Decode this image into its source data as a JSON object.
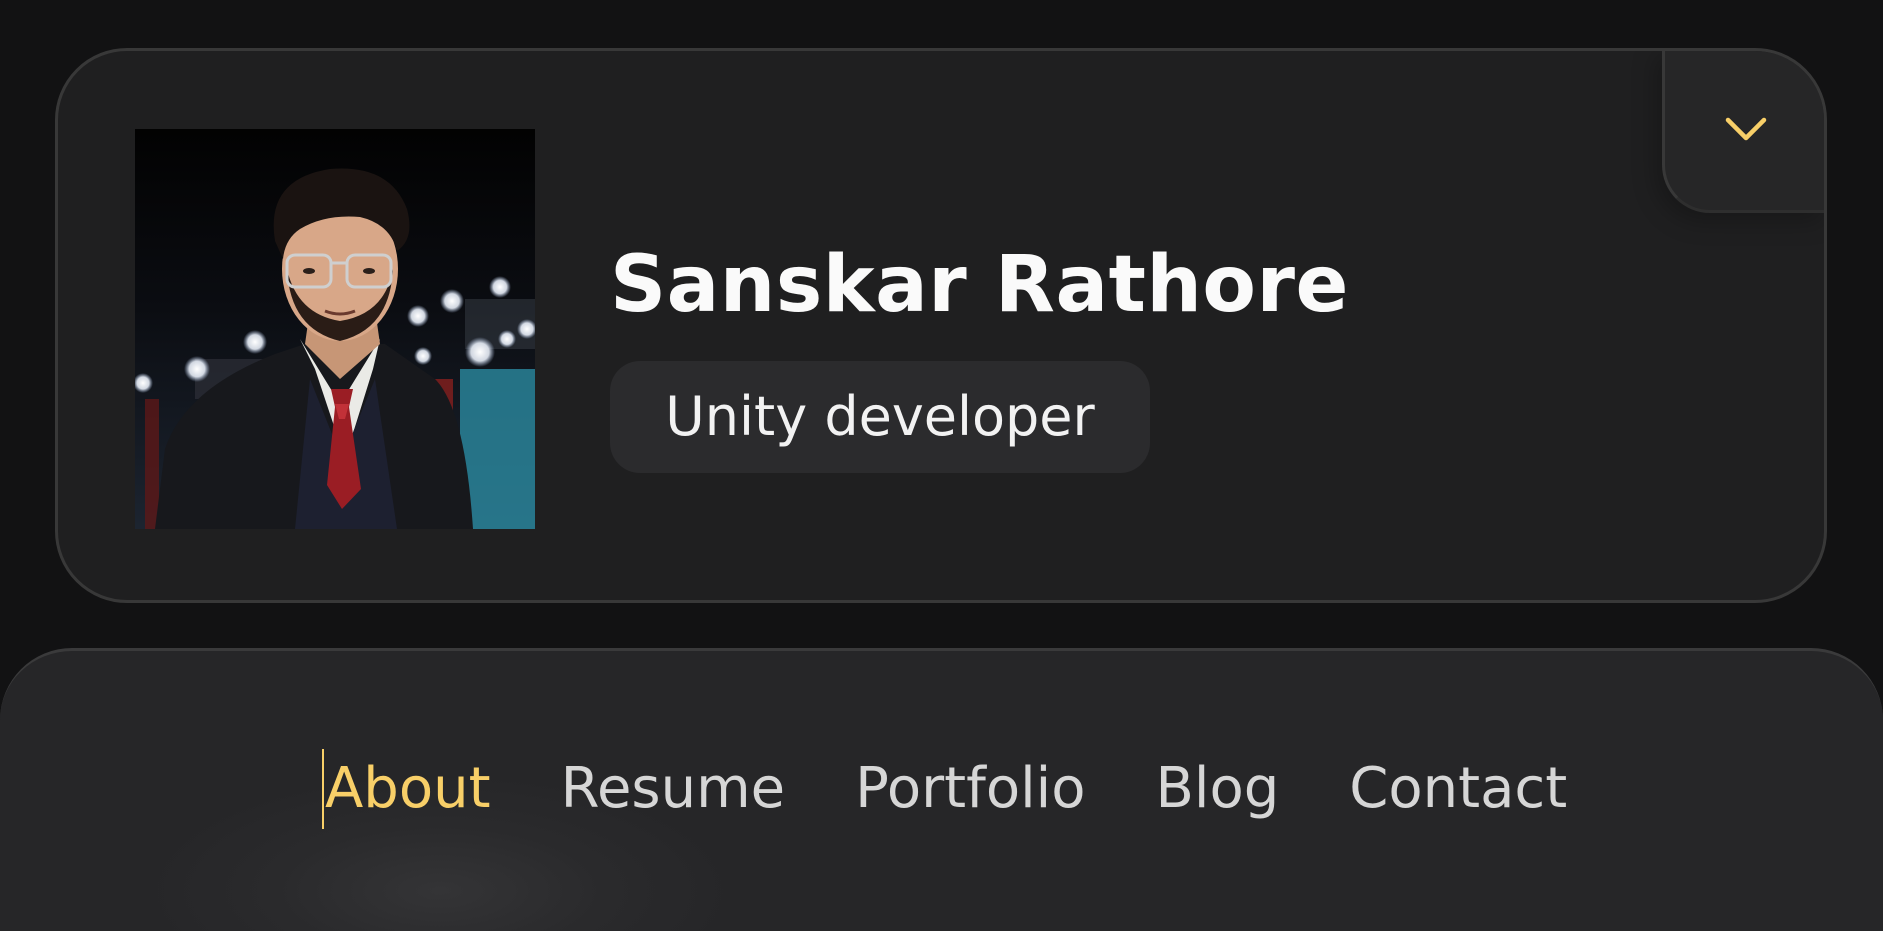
{
  "colors": {
    "background": "#121213",
    "card": "#1f1f20",
    "accent": "#f8cf68",
    "text": "#fafafa",
    "nav_text": "#d6d6d6"
  },
  "profile": {
    "name": "Sanskar Rathore",
    "role": "Unity developer",
    "avatar_alt": "Sanskar Rathore",
    "toggle_icon": "chevron-down-icon"
  },
  "nav": {
    "items": [
      {
        "label": "About",
        "active": true
      },
      {
        "label": "Resume",
        "active": false
      },
      {
        "label": "Portfolio",
        "active": false
      },
      {
        "label": "Blog",
        "active": false
      },
      {
        "label": "Contact",
        "active": false
      }
    ]
  }
}
